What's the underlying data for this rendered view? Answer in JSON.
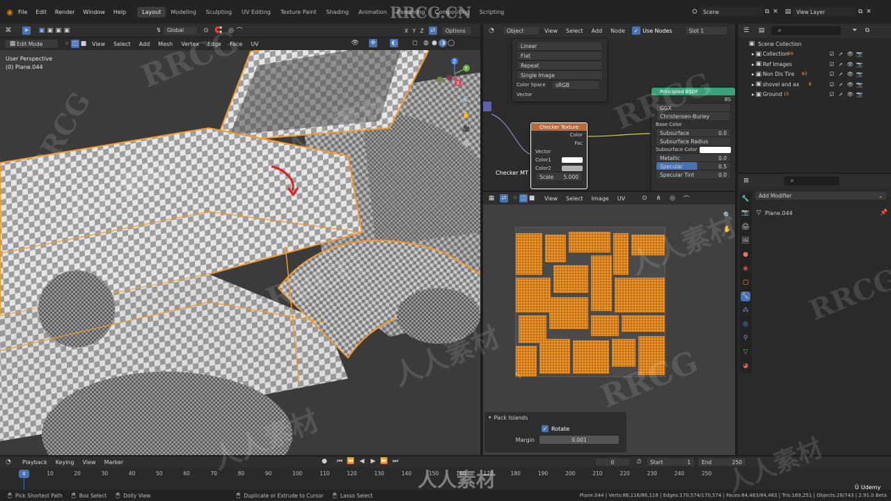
{
  "topbar": {
    "menus": [
      "File",
      "Edit",
      "Render",
      "Window",
      "Help"
    ],
    "workspaces": [
      "Layout",
      "Modeling",
      "Sculpting",
      "UV Editing",
      "Texture Paint",
      "Shading",
      "Animation",
      "Rendering",
      "Compositing",
      "Scripting"
    ],
    "active_workspace": "Layout",
    "scene": "Scene",
    "view_layer": "View Layer"
  },
  "viewport": {
    "orientation": "Global",
    "mode": "Edit Mode",
    "menus": [
      "View",
      "Select",
      "Add",
      "Mesh",
      "Vertex",
      "Edge",
      "Face",
      "UV"
    ],
    "options_label": "Options",
    "axes": [
      "X",
      "Y",
      "Z"
    ],
    "view_label": "User Perspective",
    "object_label": "(0) Plane.044"
  },
  "node_editor": {
    "object_dropdown": "Object",
    "menus": [
      "View",
      "Select",
      "Add",
      "Node"
    ],
    "use_nodes_label": "Use Nodes",
    "slot": "Slot 1",
    "image_node": {
      "rows": [
        "Linear",
        "Flat",
        "Repeat",
        "Single Image"
      ],
      "color_space_label": "Color Space",
      "color_space_value": "sRGB",
      "vector_label": "Vector"
    },
    "checker_node": {
      "title": "Checker Texture",
      "outputs": [
        "Color",
        "Fac"
      ],
      "inputs": [
        "Vector",
        "Color1",
        "Color2"
      ],
      "scale_label": "Scale",
      "scale_value": "5.000"
    },
    "material_label": "Checker MT",
    "bsdf_node": {
      "title": "Principled BSDF",
      "output_label": "BS",
      "distribution": "GGX",
      "subsurface_method": "Christensen-Burley",
      "rows": [
        {
          "label": "Base Color",
          "value": ""
        },
        {
          "label": "Subsurface",
          "value": "0.0"
        },
        {
          "label": "Subsurface Radius",
          "value": ""
        },
        {
          "label": "Subsurface Color",
          "value": ""
        },
        {
          "label": "Metallic",
          "value": "0.0"
        },
        {
          "label": "Specular",
          "value": "0.5"
        },
        {
          "label": "Specular Tint",
          "value": "0.0"
        }
      ]
    }
  },
  "outliner": {
    "root": "Scene Collection",
    "items": [
      {
        "name": "Collection",
        "count": "99"
      },
      {
        "name": "Ref Images",
        "count": ""
      },
      {
        "name": "Non Dis Tire",
        "count": "83"
      },
      {
        "name": "shovel and ax",
        "count": "8"
      },
      {
        "name": "Ground",
        "count": "15"
      }
    ]
  },
  "properties": {
    "add_modifier_label": "Add Modifier",
    "object_name": "Plane.044"
  },
  "uv_editor": {
    "menus": [
      "View",
      "Select",
      "Image",
      "UV"
    ],
    "pack_panel": {
      "title": "Pack Islands",
      "rotate_label": "Rotate",
      "margin_label": "Margin",
      "margin_value": "0.001"
    }
  },
  "timeline": {
    "menus": [
      "Playback",
      "Keying",
      "View",
      "Marker"
    ],
    "current_frame": "0",
    "start_label": "Start",
    "start_value": "1",
    "end_label": "End",
    "end_value": "250",
    "ticks": [
      "0",
      "10",
      "20",
      "30",
      "40",
      "50",
      "60",
      "70",
      "80",
      "90",
      "100",
      "110",
      "120",
      "130",
      "140",
      "150",
      "160",
      "170",
      "180",
      "190",
      "200",
      "210",
      "220",
      "230",
      "240",
      "250"
    ]
  },
  "statusbar": {
    "hints": [
      "Pick Shortest Path",
      "Box Select",
      "Dolly View",
      "Duplicate or Extrude to Cursor",
      "Lasso Select"
    ],
    "stats": "Plane.044 | Verts:86,116/86,116 | Edges:170,574/170,574 | Faces:84,483/84,483 | Tris:169,251 | Objects:28/743 | 2.91.0 Beta"
  },
  "watermarks": {
    "site": "RRCG.CN",
    "brand": "RRCG",
    "cn": "人人素材",
    "udemy": "Udemy"
  },
  "colors": {
    "accent": "#4772b3",
    "selection_orange": "#f39a2a",
    "bsdf_header": "#3ba178",
    "checker_header": "#b86a38"
  }
}
